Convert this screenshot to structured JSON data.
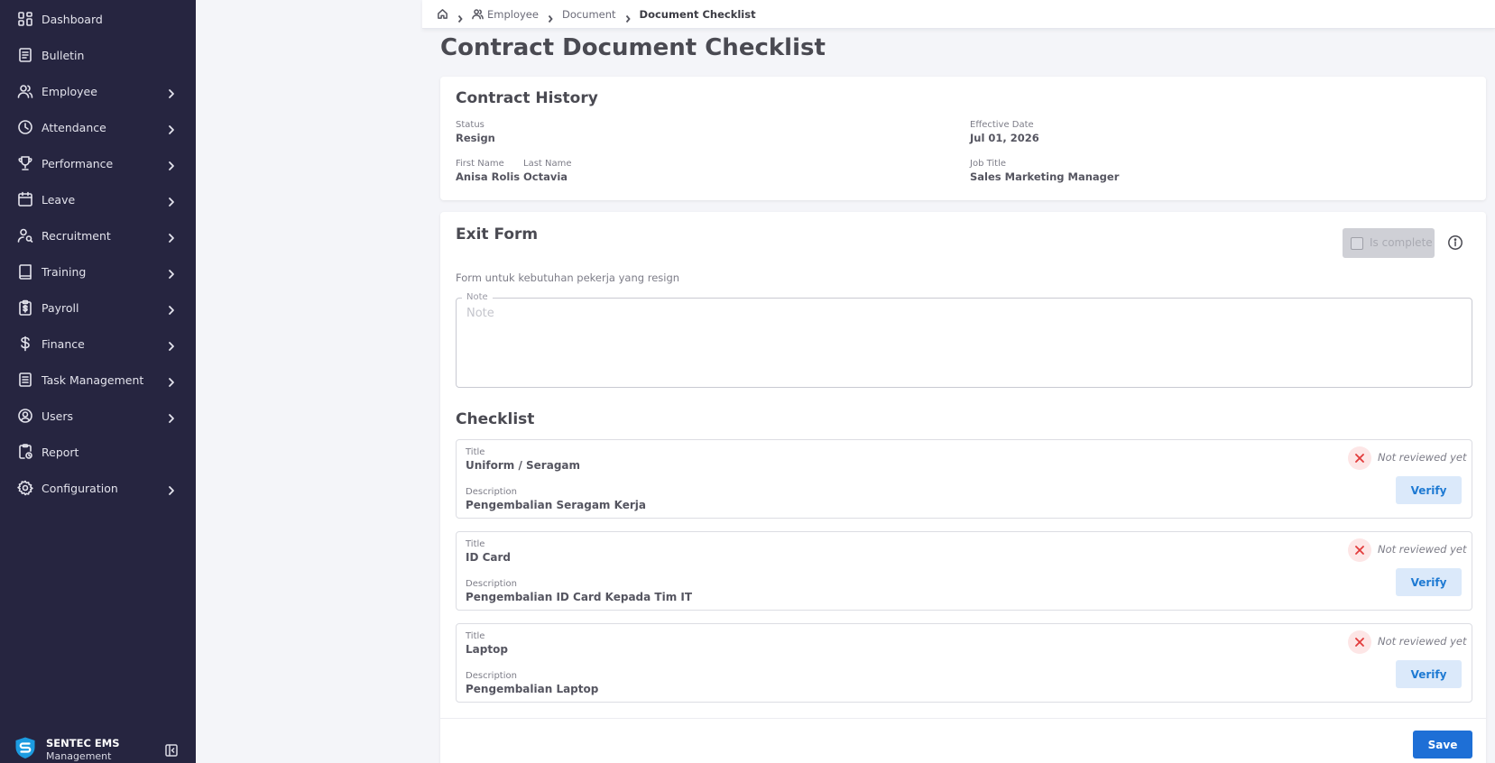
{
  "sidebar": {
    "items": [
      {
        "label": "Dashboard",
        "icon": "dashboard-icon",
        "has_submenu": false
      },
      {
        "label": "Bulletin",
        "icon": "bulletin-icon",
        "has_submenu": false
      },
      {
        "label": "Employee",
        "icon": "users-icon",
        "has_submenu": true
      },
      {
        "label": "Attendance",
        "icon": "clock-icon",
        "has_submenu": true
      },
      {
        "label": "Performance",
        "icon": "trophy-icon",
        "has_submenu": true
      },
      {
        "label": "Leave",
        "icon": "calendar-icon",
        "has_submenu": true
      },
      {
        "label": "Recruitment",
        "icon": "user-search-icon",
        "has_submenu": true
      },
      {
        "label": "Training",
        "icon": "book-icon",
        "has_submenu": true
      },
      {
        "label": "Payroll",
        "icon": "clipboard-dollar-icon",
        "has_submenu": true
      },
      {
        "label": "Finance",
        "icon": "dollar-icon",
        "has_submenu": true
      },
      {
        "label": "Task Management",
        "icon": "task-list-icon",
        "has_submenu": true
      },
      {
        "label": "Users",
        "icon": "user-circle-icon",
        "has_submenu": true
      },
      {
        "label": "Report",
        "icon": "report-icon",
        "has_submenu": false
      },
      {
        "label": "Configuration",
        "icon": "gear-icon",
        "has_submenu": true
      }
    ],
    "brand": {
      "name": "SENTEC EMS",
      "subtitle": "Management"
    }
  },
  "breadcrumb": {
    "home_icon": "home-icon",
    "items": [
      "Employee",
      "Document",
      "Document Checklist"
    ]
  },
  "page_title": "Contract Document Checklist",
  "contract_history": {
    "title": "Contract History",
    "status_label": "Status",
    "status_value": "Resign",
    "effective_date_label": "Effective Date",
    "effective_date_value": "Jul 01, 2026",
    "first_name_label": "First Name",
    "first_name_value": "Anisa Rolis",
    "last_name_label": "Last Name",
    "last_name_value": "Octavia",
    "job_title_label": "Job Title",
    "job_title_value": "Sales Marketing Manager"
  },
  "exit_form": {
    "title": "Exit Form",
    "is_complete_label": "Is complete",
    "is_complete_checked": false,
    "description": "Form untuk kebutuhan pekerja yang resign",
    "note_label": "Note",
    "note_placeholder": "Note",
    "note_value": ""
  },
  "checklist": {
    "title": "Checklist",
    "items": [
      {
        "title_label": "Title",
        "title": "Uniform / Seragam",
        "description_label": "Description",
        "description": "Pengembalian Seragam Kerja",
        "status": "Not reviewed yet",
        "action": "Verify"
      },
      {
        "title_label": "Title",
        "title": "ID Card",
        "description_label": "Description",
        "description": "Pengembalian ID Card Kepada Tim IT",
        "status": "Not reviewed yet",
        "action": "Verify"
      },
      {
        "title_label": "Title",
        "title": "Laptop",
        "description_label": "Description",
        "description": "Pengembalian Laptop",
        "status": "Not reviewed yet",
        "action": "Verify"
      }
    ]
  },
  "actions": {
    "save_label": "Save"
  },
  "colors": {
    "sidebar_bg": "#262540",
    "primary": "#1e6fd6",
    "verify_bg": "#dbe9fa",
    "status_error": "#e23b3b"
  }
}
